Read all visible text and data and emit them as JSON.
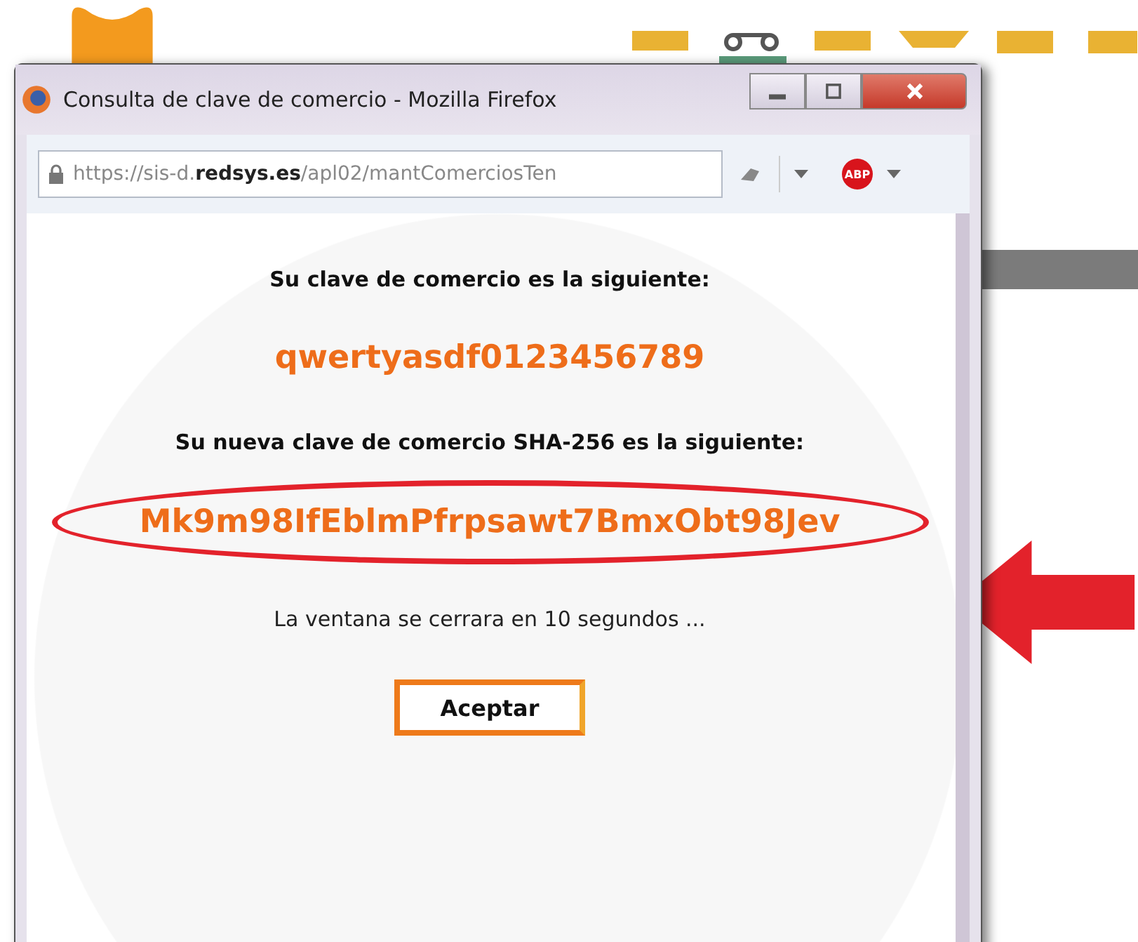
{
  "window": {
    "title": "Consulta de clave de comercio - Mozilla Firefox",
    "url": "https://sis-d.**redsys.es**/apl02/mantComerciosTen",
    "adblock_badge": "ABP"
  },
  "content": {
    "label_1": "Su clave de comercio es la siguiente:",
    "key": "qwertyasdf0123456789",
    "label_2": "Su nueva clave de comercio SHA-256 es la siguiente:",
    "sha256_key": "Mk9m98IfEblmPfrpsawt7BmxObt98Jev",
    "countdown": "La ventana se cerrara en 10 segundos ...",
    "button": "Aceptar"
  }
}
